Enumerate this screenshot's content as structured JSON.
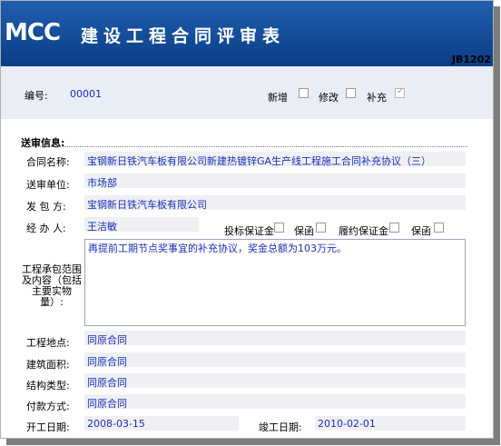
{
  "header": {
    "logo": "MCC",
    "title": "建设工程合同评审表",
    "code": "JB1202"
  },
  "form": {
    "number_label": "编号:",
    "number_value": "00001",
    "checkboxes": [
      {
        "label": "新增",
        "checked": false
      },
      {
        "label": "修改",
        "checked": false
      },
      {
        "label": "补充",
        "checked": true
      }
    ]
  },
  "section": {
    "title": "送审信息:"
  },
  "fields": {
    "contract_name": {
      "label": "合同名称:",
      "value": "宝钢新日铁汽车板有限公司新建热镀锌GA生产线工程施工合同补充协议（三）"
    },
    "submit_unit": {
      "label": "送审单位:",
      "value": "市场部"
    },
    "contractor": {
      "label": "发 包 方:",
      "value": "宝钢新日铁汽车板有限公司"
    },
    "handler": {
      "label": "经 办 人:",
      "value": "王洁敏"
    },
    "guarantees": [
      {
        "label": "投标保证金",
        "checked": false
      },
      {
        "label": "保函",
        "checked": false
      },
      {
        "label": "履约保证金",
        "checked": false
      },
      {
        "label": "保函",
        "checked": false
      }
    ],
    "scope": {
      "label": "工程承包范围及内容（包括主要实物量）:",
      "value": "再提前工期节点奖事宜的补充协议，奖金总额为103万元。"
    },
    "location": {
      "label": "工程地点:",
      "value": "同原合同"
    },
    "area": {
      "label": "建筑面积:",
      "value": "同原合同"
    },
    "structure": {
      "label": "结构类型:",
      "value": "同原合同"
    },
    "payment": {
      "label": "付款方式:",
      "value": "同原合同"
    },
    "start_date": {
      "label": "开工日期:",
      "value": "2008-03-15"
    },
    "end_date": {
      "label": "竣工日期:",
      "value": "2010-02-01"
    }
  }
}
